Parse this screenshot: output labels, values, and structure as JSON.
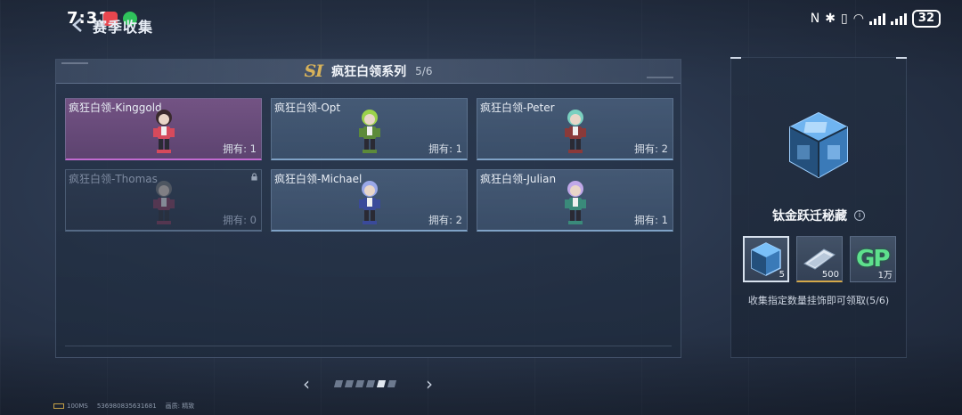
{
  "status_bar": {
    "time": "7:31",
    "battery": "32"
  },
  "header": {
    "title": "赛季收集",
    "back_icon": "back-arrow-icon"
  },
  "series": {
    "logo": "SI",
    "name": "疯狂白领系列",
    "progress": "5/6"
  },
  "cards": [
    {
      "name": "疯狂白领-Kinggold",
      "owned": "拥有: 1",
      "state": "highlight",
      "figure_color": "#d64a5c",
      "hair_color": "#3a2a2e"
    },
    {
      "name": "疯狂白领-Opt",
      "owned": "拥有: 1",
      "state": "normal",
      "figure_color": "#5c8a3a",
      "hair_color": "#9bd24a"
    },
    {
      "name": "疯狂白领-Peter",
      "owned": "拥有: 2",
      "state": "normal",
      "figure_color": "#8a3a3a",
      "hair_color": "#7ad0c0"
    },
    {
      "name": "疯狂白领-Thomas",
      "owned": "拥有: 0",
      "state": "locked",
      "figure_color": "#8a3a5a",
      "hair_color": "#7a7a7a"
    },
    {
      "name": "疯狂白领-Michael",
      "owned": "拥有: 2",
      "state": "normal",
      "figure_color": "#3a4a9a",
      "hair_color": "#9aa8e8"
    },
    {
      "name": "疯狂白领-Julian",
      "owned": "拥有: 1",
      "state": "normal",
      "figure_color": "#3a8a7a",
      "hair_color": "#c0a8e8"
    }
  ],
  "pagination": {
    "total": 6,
    "active_index": 4
  },
  "footer": {
    "ping": "100MS",
    "id": "536980835631681",
    "quality_label": "画质:",
    "quality": "精致"
  },
  "reward": {
    "name": "钛金跃迁秘藏",
    "info_icon": "info-icon",
    "items": [
      {
        "icon": "cube-crate-icon",
        "qty": "5",
        "selected": true
      },
      {
        "icon": "voucher-card-icon",
        "qty": "500",
        "selected": false
      },
      {
        "icon": "gp-currency-icon",
        "label": "GP",
        "qty": "1万",
        "selected": false
      }
    ],
    "description": "收集指定数量挂饰即可领取(5/6)"
  }
}
